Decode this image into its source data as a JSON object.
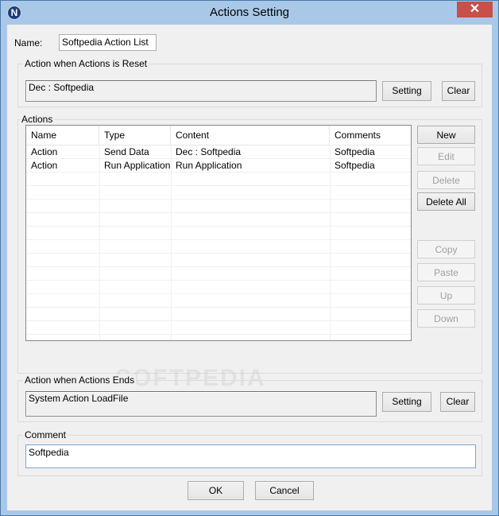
{
  "window": {
    "title": "Actions Setting",
    "app_icon_letter": "N",
    "close_glyph": "✕"
  },
  "name_field": {
    "label": "Name:",
    "value": "Softpedia Action List"
  },
  "reset_group": {
    "title": "Action when Actions is Reset",
    "value": "Dec : Softpedia",
    "setting_label": "Setting",
    "clear_label": "Clear"
  },
  "actions_group": {
    "title": "Actions",
    "columns": [
      "Name",
      "Type",
      "Content",
      "Comments"
    ],
    "rows": [
      [
        "Action",
        "Send Data",
        "Dec : Softpedia",
        "Softpedia"
      ],
      [
        "Action",
        "Run Application",
        "Run Application",
        "Softpedia"
      ]
    ],
    "buttons": {
      "new": "New",
      "edit": "Edit",
      "delete": "Delete",
      "delete_all": "Delete All",
      "copy": "Copy",
      "paste": "Paste",
      "up": "Up",
      "down": "Down"
    }
  },
  "ends_group": {
    "title": "Action when Actions Ends",
    "value": "System Action LoadFile",
    "setting_label": "Setting",
    "clear_label": "Clear"
  },
  "comment_group": {
    "title": "Comment",
    "value": "Softpedia"
  },
  "footer": {
    "ok_label": "OK",
    "cancel_label": "Cancel"
  },
  "watermark_text": "SOFTPEDIA"
}
